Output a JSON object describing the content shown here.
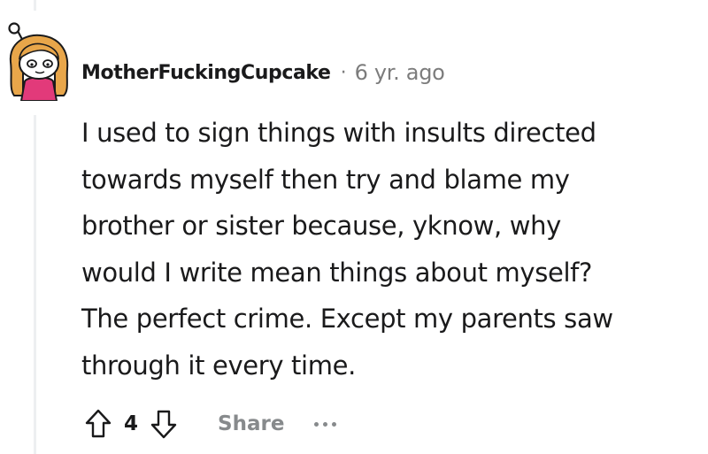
{
  "comment": {
    "author": "MotherFuckingCupcake",
    "separator": "·",
    "timestamp": "6 yr. ago",
    "body_lines": [
      "I used to sign things with insults directed",
      "towards myself then try and blame my",
      "brother or sister because, yknow, why",
      "would I write mean things about myself?",
      "The perfect crime. Except my parents saw",
      "through it every time."
    ],
    "score": "4",
    "share_label": "Share",
    "avatar_icon": "snoo-avatar-icon"
  },
  "icons": {
    "upvote": "arrow-up-icon",
    "downvote": "arrow-down-icon",
    "more": "more-options-icon"
  },
  "colors": {
    "text": "#1a1a1b",
    "meta": "#7c7c7c",
    "action": "#878a8c",
    "thread_line": "#edeff1",
    "avatar_hair": "#e8a64a",
    "avatar_shirt": "#e23a7a"
  }
}
